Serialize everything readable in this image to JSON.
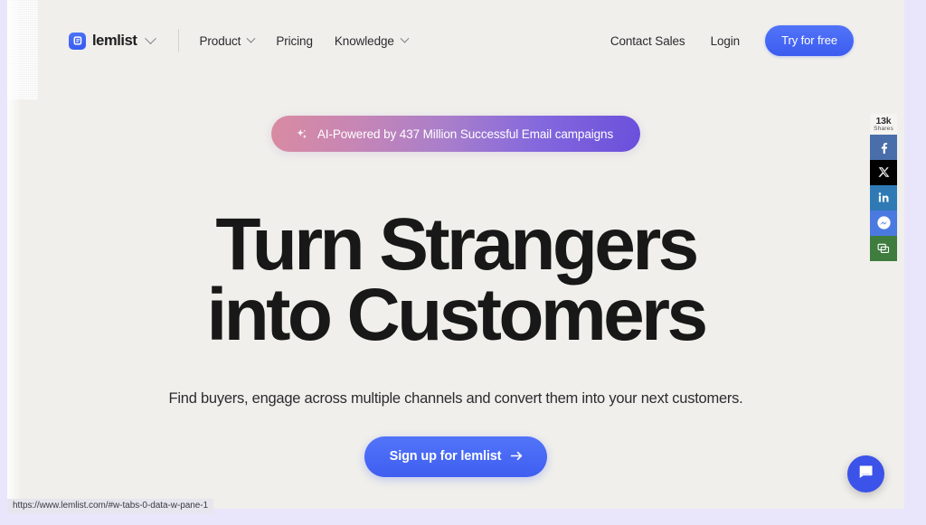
{
  "browser": {
    "status_url": "https://www.lemlist.com/#w-tabs-0-data-w-pane-1"
  },
  "navbar": {
    "brand": "lemlist",
    "brand_icon": "lemlist-logo-icon",
    "brand_chevron_icon": "chevron-down-icon",
    "links": [
      {
        "label": "Product",
        "has_chevron": true
      },
      {
        "label": "Pricing",
        "has_chevron": false
      },
      {
        "label": "Knowledge",
        "has_chevron": true
      }
    ],
    "contact_sales": "Contact Sales",
    "login": "Login",
    "try_free": "Try for free"
  },
  "hero": {
    "badge": {
      "icon": "sparkle-icon",
      "text": "AI-Powered by 437 Million Successful Email campaigns",
      "gradient_from": "#d98ba1",
      "gradient_to": "#6a4fdc"
    },
    "headline_line1": "Turn Strangers",
    "headline_line2": "into Customers",
    "subheadline": "Find buyers, engage across multiple channels and convert them into your next customers.",
    "cta_label": "Sign up for lemlist",
    "cta_icon": "arrow-right-icon",
    "cta_color": "#3f5ef1"
  },
  "share_rail": {
    "count": "13k",
    "count_label": "Shares",
    "buttons": [
      {
        "name": "facebook-share-button",
        "icon": "facebook-icon",
        "color": "#4a6ea9"
      },
      {
        "name": "x-share-button",
        "icon": "x-twitter-icon",
        "color": "#000000"
      },
      {
        "name": "linkedin-share-button",
        "icon": "linkedin-icon",
        "color": "#2f7ab5"
      },
      {
        "name": "messenger-share-button",
        "icon": "messenger-icon",
        "color": "#4a7ae0"
      },
      {
        "name": "sms-share-button",
        "icon": "sms-icon",
        "color": "#3f7d3f"
      }
    ]
  },
  "chat": {
    "icon": "chat-bubble-icon",
    "color": "#3b53e8"
  },
  "theme": {
    "page_background": "#f0efeb",
    "frame_background": "#e9e5fb",
    "accent_blue": "#3f5ef1",
    "text_dark": "#181818"
  }
}
